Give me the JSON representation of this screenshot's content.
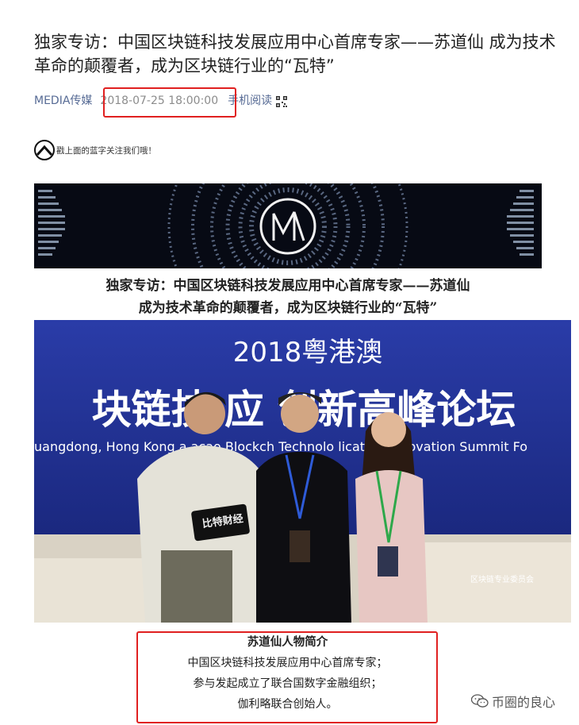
{
  "article": {
    "title": "独家专访：中国区块链科技发展应用中心首席专家——苏道仙 成为技术革命的颠覆者，成为区块链行业的“瓦特”",
    "source": "MEDIA传媒",
    "date": "2018-07-25 18:00:00",
    "mobile_read": "手机阅读",
    "qr_icon": "qr-code-icon",
    "follow_text": "戳上面的蓝字关注我们哦！",
    "caption_line1": "独家专访：中国区块链科技发展应用中心首席专家——苏道仙",
    "caption_line2": "成为技术革命的颠覆者，成为区块链行业的“瓦特”"
  },
  "banner": {
    "logo_icon": "m-logo-icon"
  },
  "photo": {
    "backdrop_year": "2018粤港澳",
    "backdrop_title": "块链技 应 创新高峰论坛",
    "backdrop_english": "uangdong, Hong Kong a    acao Blockch   Technolo   lication Innovation Summit Fo",
    "card_text": "比特财经",
    "committee_text": "区块链专业委员会"
  },
  "bio": {
    "title": "苏道仙人物简介",
    "lines": [
      "中国区块链科技发展应用中心首席专家；",
      "参与发起成立了联合国数字金融组织；",
      "伽利略联合创始人。"
    ]
  },
  "watermark": {
    "icon": "wechat-icon",
    "text": "币圈的良心"
  },
  "colors": {
    "link": "#576b95",
    "highlight_box": "#e02020",
    "backdrop_blue": "#1b2a8a"
  }
}
